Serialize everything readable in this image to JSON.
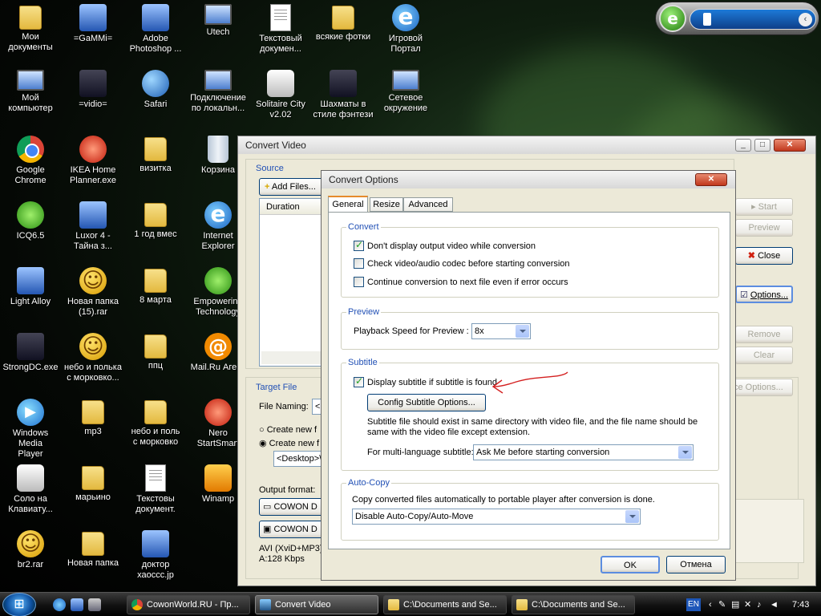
{
  "desktop_icons": [
    {
      "label": "Мои\nдокументы",
      "icon": "folder-docs-icon"
    },
    {
      "label": "=GaMMi=",
      "icon": "app-icon"
    },
    {
      "label": "Adobe\nPhotoshop ...",
      "icon": "photoshop-icon"
    },
    {
      "label": "Utech",
      "icon": "network-pc-icon"
    },
    {
      "label": "Текстовый\nдокумен...",
      "icon": "text-document-icon"
    },
    {
      "label": "всякие фотки",
      "icon": "folder-icon"
    },
    {
      "label": "Игровой\nПортал",
      "icon": "ie-icon"
    },
    {
      "label": "Мой\nкомпьютер",
      "icon": "my-computer-icon"
    },
    {
      "label": "=vidio=",
      "icon": "video-folder-icon"
    },
    {
      "label": "Safari",
      "icon": "safari-icon"
    },
    {
      "label": "Подключение\nпо локальн...",
      "icon": "network-connection-icon"
    },
    {
      "label": "Solitaire City\nv2.02",
      "icon": "cards-icon"
    },
    {
      "label": "Шахматы в\nстиле фэнтези",
      "icon": "chess-icon"
    },
    {
      "label": "Сетевое\nокружение",
      "icon": "network-places-icon"
    },
    {
      "label": "Google Chrome",
      "icon": "chrome-icon"
    },
    {
      "label": "IKEA Home\nPlanner.exe",
      "icon": "ikea-icon"
    },
    {
      "label": "визитка",
      "icon": "folder-icon"
    },
    {
      "label": "Корзина",
      "icon": "recycle-bin-icon"
    },
    {
      "label": "ICQ6.5",
      "icon": "icq-icon"
    },
    {
      "label": "Luxor 4 -\nТайна з...",
      "icon": "luxor-icon"
    },
    {
      "label": "1 год вмес",
      "icon": "folder-icon"
    },
    {
      "label": "Internet\nExplorer",
      "icon": "ie-icon"
    },
    {
      "label": "Light Alloy",
      "icon": "light-alloy-icon"
    },
    {
      "label": "Новая папка\n(15).rar",
      "icon": "smiley-archive-icon"
    },
    {
      "label": "8 марта",
      "icon": "folder-icon"
    },
    {
      "label": "Empowering\nTechnology",
      "icon": "empowering-icon"
    },
    {
      "label": "StrongDC.exe",
      "icon": "strongdc-icon"
    },
    {
      "label": "небо и полька\nс морковко...",
      "icon": "smiley-archive-icon"
    },
    {
      "label": "ппц",
      "icon": "folder-icon"
    },
    {
      "label": "Mail.Ru Агент",
      "icon": "mail-agent-icon"
    },
    {
      "label": "Windows Media\nPlayer",
      "icon": "media-player-icon"
    },
    {
      "label": "mp3",
      "icon": "folder-icon"
    },
    {
      "label": "небо и поль\nс морковко",
      "icon": "folder-icon"
    },
    {
      "label": "Nero\nStartSmart",
      "icon": "nero-icon"
    },
    {
      "label": "Соло на\nКлавиату...",
      "icon": "keyboard-icon"
    },
    {
      "label": "марьино",
      "icon": "folder-icon"
    },
    {
      "label": "Текстовы\nдокумент.",
      "icon": "text-document-icon"
    },
    {
      "label": "Winamp",
      "icon": "winamp-icon"
    },
    {
      "label": "br2.rar",
      "icon": "smiley-archive-icon"
    },
    {
      "label": "Новая папка",
      "icon": "folder-icon"
    },
    {
      "label": "доктор\nхаоссс.jp",
      "icon": "image-file-icon"
    }
  ],
  "convert_video": {
    "title": "Convert Video",
    "source_label": "Source",
    "add_files": "Add Files...",
    "duration_header": "Duration",
    "target_file_label": "Target File",
    "file_naming_label": "File Naming:",
    "file_naming_value": "<",
    "create_new_1": "Create new f",
    "create_new_2": "Create new f",
    "folder_value": "<Desktop>\\",
    "output_format_label": "Output format:",
    "output_1": "COWON D",
    "output_2": "COWON D",
    "format_line_1": "AVI (XviD+MP3)",
    "format_line_2": "A:128 Kbps",
    "start": "Start",
    "preview": "Preview",
    "close": "Close",
    "options": "Options...",
    "remove": "Remove",
    "clear": "Clear",
    "device_options": "ce Options..."
  },
  "convert_options": {
    "title": "Convert Options",
    "tabs": [
      "General",
      "Resize",
      "Advanced"
    ],
    "convert_group": "Convert",
    "opt1": "Don't display output video while conversion",
    "opt2": "Check video/audio codec before starting conversion",
    "opt3": "Continue conversion to next file even if error occurs",
    "preview_group": "Preview",
    "playback_label": "Playback Speed for Preview :",
    "playback_value": "8x",
    "subtitle_group": "Subtitle",
    "display_subtitle": "Display subtitle if subtitle is found",
    "config_subtitle": "Config Subtitle Options...",
    "subtitle_note_1": "Subtitle file should exist in same directory with video file, and the file name should be",
    "subtitle_note_2": "same with the video file except extension.",
    "multilang_label": "For multi-language subtitle:",
    "multilang_value": "Ask Me before starting conversion",
    "autocopy_group": "Auto-Copy",
    "autocopy_text": "Copy converted files automatically to portable player after conversion is done.",
    "autocopy_value": "Disable Auto-Copy/Auto-Move",
    "ok": "OK",
    "cancel": "Отмена"
  },
  "taskbar": {
    "tasks": [
      {
        "label": "CowonWorld.RU - Пр...",
        "icon": "chrome-icon"
      },
      {
        "label": "Convert Video",
        "icon": "convert-video-icon"
      },
      {
        "label": "C:\\Documents and Se...",
        "icon": "folder-icon"
      },
      {
        "label": "C:\\Documents and Se...",
        "icon": "folder-icon"
      }
    ],
    "language": "EN",
    "clock": "7:43"
  },
  "colors": {
    "accent": "#2150b5",
    "annotation_arrow": "#d42020"
  }
}
